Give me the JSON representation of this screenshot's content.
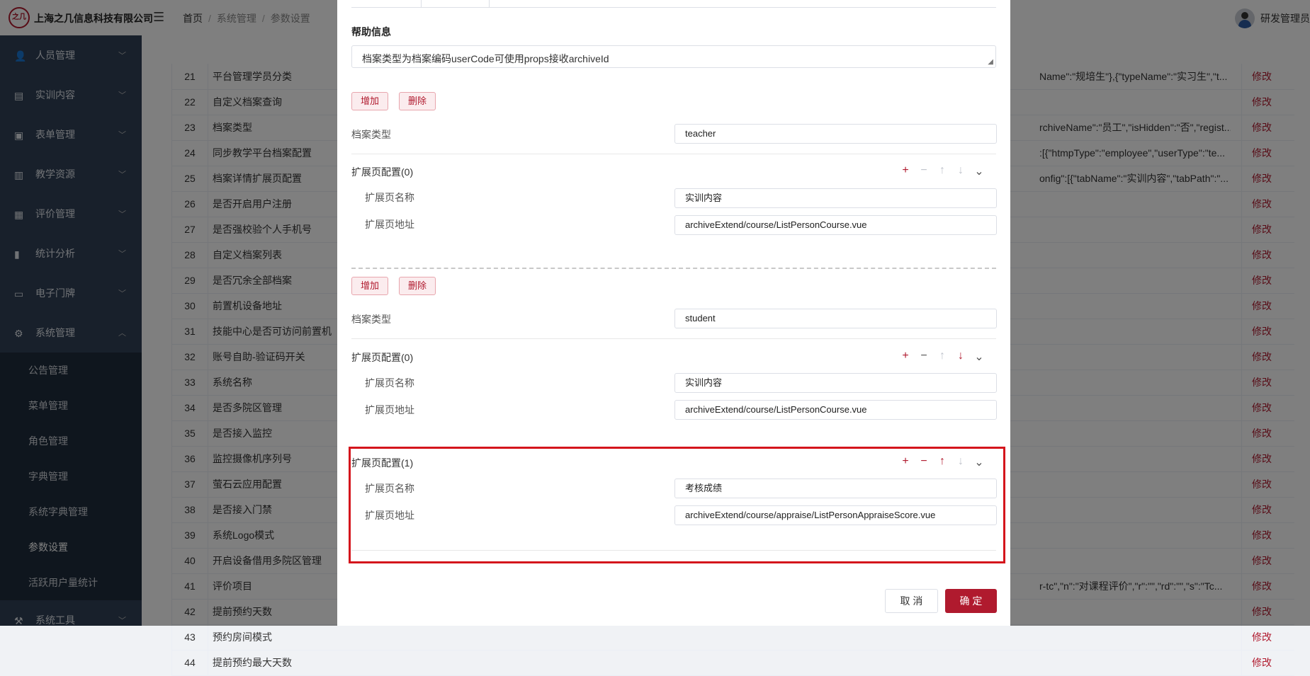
{
  "header": {
    "logo_text": "之几",
    "company": "上海之几信息科技有限公司",
    "breadcrumb": [
      "首页",
      "系统管理",
      "参数设置"
    ],
    "user_name": "研发管理员"
  },
  "sidebar": {
    "items": [
      {
        "label": "人员管理"
      },
      {
        "label": "实训内容"
      },
      {
        "label": "表单管理"
      },
      {
        "label": "教学资源"
      },
      {
        "label": "评价管理"
      },
      {
        "label": "统计分析"
      },
      {
        "label": "电子门牌"
      },
      {
        "label": "系统管理"
      }
    ],
    "sub_items": [
      {
        "label": "公告管理"
      },
      {
        "label": "菜单管理"
      },
      {
        "label": "角色管理"
      },
      {
        "label": "字典管理"
      },
      {
        "label": "系统字典管理"
      },
      {
        "label": "参数设置"
      },
      {
        "label": "活跃用户量统计"
      }
    ],
    "bottom_item": "系统工具"
  },
  "table": {
    "action_label": "修改",
    "rows": [
      {
        "no": "21",
        "name": "平台管理学员分类",
        "value": "Name\":\"规培生\"},{\"typeName\":\"实习生\",\"t..."
      },
      {
        "no": "22",
        "name": "自定义档案查询",
        "value": ""
      },
      {
        "no": "23",
        "name": "档案类型",
        "value": "rchiveName\":\"员工\",\"isHidden\":\"否\",\"regist..."
      },
      {
        "no": "24",
        "name": "同步教学平台档案配置",
        "value": ":[{\"htmpType\":\"employee\",\"userType\":\"te..."
      },
      {
        "no": "25",
        "name": "档案详情扩展页配置",
        "value": "onfig\":[{\"tabName\":\"实训内容\",\"tabPath\":\"..."
      },
      {
        "no": "26",
        "name": "是否开启用户注册",
        "value": ""
      },
      {
        "no": "27",
        "name": "是否强校验个人手机号",
        "value": ""
      },
      {
        "no": "28",
        "name": "自定义档案列表",
        "value": ""
      },
      {
        "no": "29",
        "name": "是否冗余全部档案",
        "value": ""
      },
      {
        "no": "30",
        "name": "前置机设备地址",
        "value": ""
      },
      {
        "no": "31",
        "name": "技能中心是否可访问前置机",
        "value": ""
      },
      {
        "no": "32",
        "name": "账号自助-验证码开关",
        "value": ""
      },
      {
        "no": "33",
        "name": "系统名称",
        "value": ""
      },
      {
        "no": "34",
        "name": "是否多院区管理",
        "value": ""
      },
      {
        "no": "35",
        "name": "是否接入监控",
        "value": ""
      },
      {
        "no": "36",
        "name": "监控摄像机序列号",
        "value": ""
      },
      {
        "no": "37",
        "name": "萤石云应用配置",
        "value": ""
      },
      {
        "no": "38",
        "name": "是否接入门禁",
        "value": ""
      },
      {
        "no": "39",
        "name": "系统Logo模式",
        "value": ""
      },
      {
        "no": "40",
        "name": "开启设备借用多院区管理",
        "value": ""
      },
      {
        "no": "41",
        "name": "评价项目",
        "value": "r-tc\",\"n\":\"对课程评价\",\"r\":\"\",\"rd\":\"\",\"s\":\"Tc..."
      },
      {
        "no": "42",
        "name": "提前预约天数",
        "value": ""
      },
      {
        "no": "43",
        "name": "预约房间模式",
        "value": ""
      },
      {
        "no": "44",
        "name": "提前预约最大天数",
        "value": ""
      }
    ]
  },
  "dialog": {
    "help_title": "帮助信息",
    "help_text": "档案类型为档案编码userCode可使用props接收archiveId",
    "add_label": "增加",
    "delete_label": "删除",
    "archive_type_label": "档案类型",
    "ext_name_label": "扩展页名称",
    "ext_addr_label": "扩展页地址",
    "groups": [
      {
        "archive_type": "teacher",
        "configs": [
          {
            "title": "扩展页配置(0)",
            "name": "实训内容",
            "addr": "archiveExtend/course/ListPersonCourse.vue"
          }
        ]
      },
      {
        "archive_type": "student",
        "configs": [
          {
            "title": "扩展页配置(0)",
            "name": "实训内容",
            "addr": "archiveExtend/course/ListPersonCourse.vue"
          },
          {
            "title": "扩展页配置(1)",
            "name": "考核成绩",
            "addr": "archiveExtend/course/appraise/ListPersonAppraiseScore.vue"
          }
        ]
      }
    ],
    "cancel_label": "取 消",
    "ok_label": "确 定"
  },
  "colors": {
    "brand": "#b01a2e",
    "sidebar_bg": "#304156",
    "highlight_border": "#d4151c"
  }
}
